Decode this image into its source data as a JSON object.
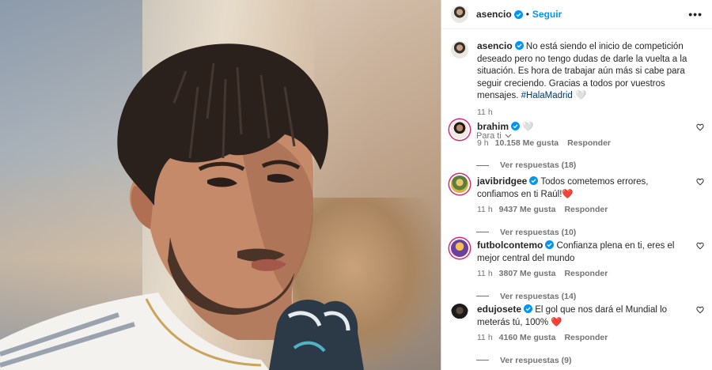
{
  "post": {
    "author": "asencio",
    "follow_label": "Seguir",
    "more_icon": "more-options-icon",
    "caption_text": "No está siendo el inicio de competición deseado pero no tengo dudas de darle la vuelta a la situación. Es hora de trabajar aún más si cabe para seguir creciendo. Gracias a todos por vuestros mensajes.",
    "caption_hashtag": "#HalaMadrid",
    "caption_emoji": "🤍",
    "time": "11 h"
  },
  "sort": {
    "label": "Para ti"
  },
  "comments": [
    {
      "user": "brahim",
      "text": "🤍",
      "time": "9 h",
      "likes": "10.158 Me gusta",
      "reply": "Responder",
      "replies": "Ver respuestas (18)"
    },
    {
      "user": "javibridgee",
      "text": "Todos cometemos errores, confiamos en ti Raúl!❤️",
      "time": "11 h",
      "likes": "9437 Me gusta",
      "reply": "Responder",
      "replies": "Ver respuestas (10)"
    },
    {
      "user": "futbolcontemo",
      "text": "Confianza plena en ti, eres el mejor central del mundo",
      "time": "11 h",
      "likes": "3807 Me gusta",
      "reply": "Responder",
      "replies": "Ver respuestas (14)"
    },
    {
      "user": "edujosete",
      "text": "El gol que nos dará el Mundial lo meterás tú, 100% ❤️",
      "time": "11 h",
      "likes": "4160 Me gusta",
      "reply": "Responder",
      "replies": "Ver respuestas (9)"
    }
  ],
  "colors": {
    "link": "#0095f6",
    "hashtag": "#00376b",
    "muted": "#737373",
    "verified": "#0095f6"
  }
}
